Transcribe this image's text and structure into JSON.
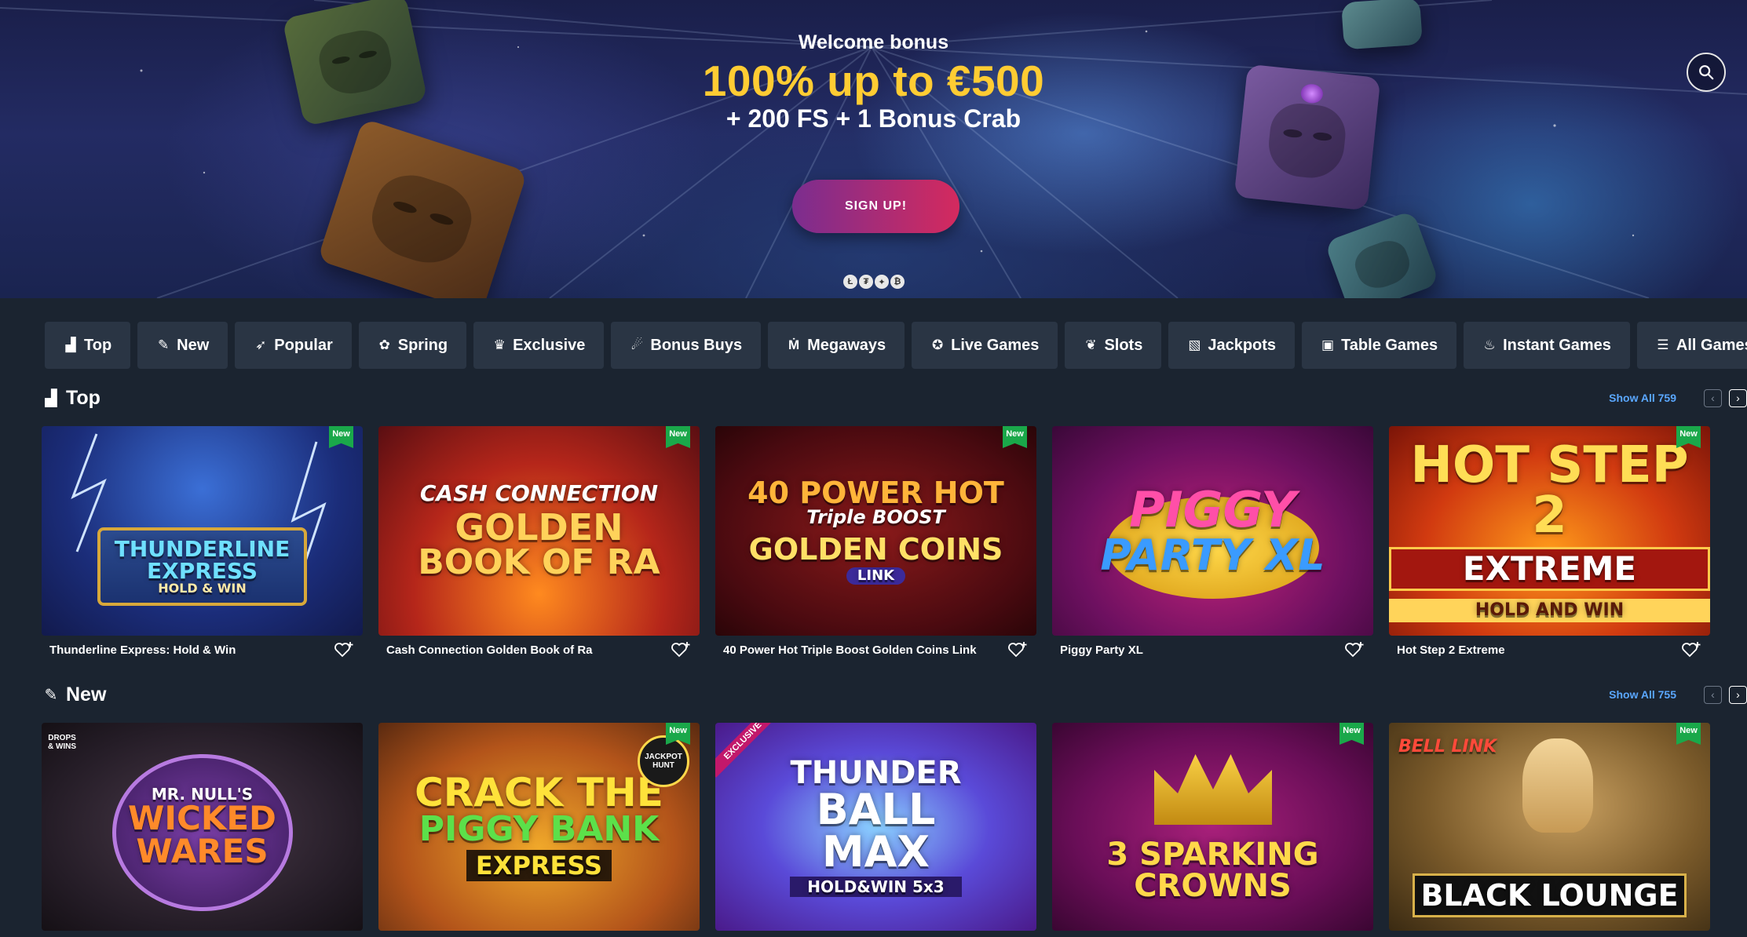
{
  "hero": {
    "kicker": "Welcome bonus",
    "headline": "100% up to €500",
    "sub": "+ 200 FS + 1 Bonus Crab",
    "cta": "SIGN UP!",
    "payment_dots": [
      "Ł",
      "₮",
      "✦",
      "₿"
    ]
  },
  "categories": [
    {
      "label": "Top",
      "icon": "podium-icon",
      "glyph": "▟"
    },
    {
      "label": "New",
      "icon": "new-badge-icon",
      "glyph": "✎"
    },
    {
      "label": "Popular",
      "icon": "rocket-icon",
      "glyph": "➶"
    },
    {
      "label": "Spring",
      "icon": "butterfly-icon",
      "glyph": "✿"
    },
    {
      "label": "Exclusive",
      "icon": "crown-icon",
      "glyph": "♛"
    },
    {
      "label": "Bonus Buys",
      "icon": "bonus-buy-icon",
      "glyph": "☄"
    },
    {
      "label": "Megaways",
      "icon": "megaways-icon",
      "glyph": "Ṁ"
    },
    {
      "label": "Live Games",
      "icon": "roulette-icon",
      "glyph": "✪"
    },
    {
      "label": "Slots",
      "icon": "cherries-icon",
      "glyph": "❦"
    },
    {
      "label": "Jackpots",
      "icon": "jackpot-icon",
      "glyph": "▧"
    },
    {
      "label": "Table Games",
      "icon": "cards-icon",
      "glyph": "▣"
    },
    {
      "label": "Instant Games",
      "icon": "instant-icon",
      "glyph": "♨"
    },
    {
      "label": "All Games",
      "icon": "list-icon",
      "glyph": "☰"
    }
  ],
  "sections": {
    "top": {
      "title": "Top",
      "icon": "podium-icon",
      "show_all": "Show All 759",
      "games": [
        {
          "title": "Thunderline Express: Hold & Win",
          "art_lines": [
            "THUNDERLINE",
            "EXPRESS",
            "HOLD & WIN"
          ],
          "badge": "New"
        },
        {
          "title": "Cash Connection Golden Book of Ra",
          "art_lines": [
            "CASH CONNECTION",
            "GOLDEN",
            "BOOK OF RA"
          ],
          "badge": "New"
        },
        {
          "title": "40 Power Hot Triple Boost Golden Coins Link",
          "art_lines": [
            "40 POWER HOT",
            "Triple BOOST",
            "GOLDEN COINS",
            "LINK"
          ],
          "badge": "New"
        },
        {
          "title": "Piggy Party XL",
          "art_lines": [
            "PIGGY",
            "PARTY XL"
          ],
          "badge": ""
        },
        {
          "title": "Hot Step 2 Extreme",
          "art_lines": [
            "HOT STEP 2",
            "EXTREME",
            "HOLD AND WIN"
          ],
          "badge": "New"
        }
      ]
    },
    "new": {
      "title": "New",
      "icon": "new-badge-icon",
      "show_all": "Show All 755",
      "games": [
        {
          "art_lines": [
            "MR. NULL'S",
            "WICKED",
            "WARES"
          ],
          "badge": "",
          "corner": "DROPS & WINS"
        },
        {
          "art_lines": [
            "CRACK THE",
            "PIGGY BANK",
            "EXPRESS"
          ],
          "badge": "New",
          "corner": "JACKPOT HUNT"
        },
        {
          "art_lines": [
            "THUNDER",
            "BALL",
            "MAX",
            "HOLD&WIN 5x3"
          ],
          "badge": "",
          "corner": "EXCLUSIVE"
        },
        {
          "art_lines": [
            "3 SPARKING",
            "CROWNS"
          ],
          "badge": "New",
          "corner": ""
        },
        {
          "art_lines": [
            "BELL LINK",
            "BLACK LOUNGE"
          ],
          "badge": "New",
          "corner": ""
        }
      ]
    }
  },
  "colors": {
    "page_bg": "#1b2430",
    "chip_bg": "#2a3544",
    "accent_link": "#5aa7ff",
    "headline_gold": "#ffcc33",
    "badge_green": "#1aa84a"
  }
}
